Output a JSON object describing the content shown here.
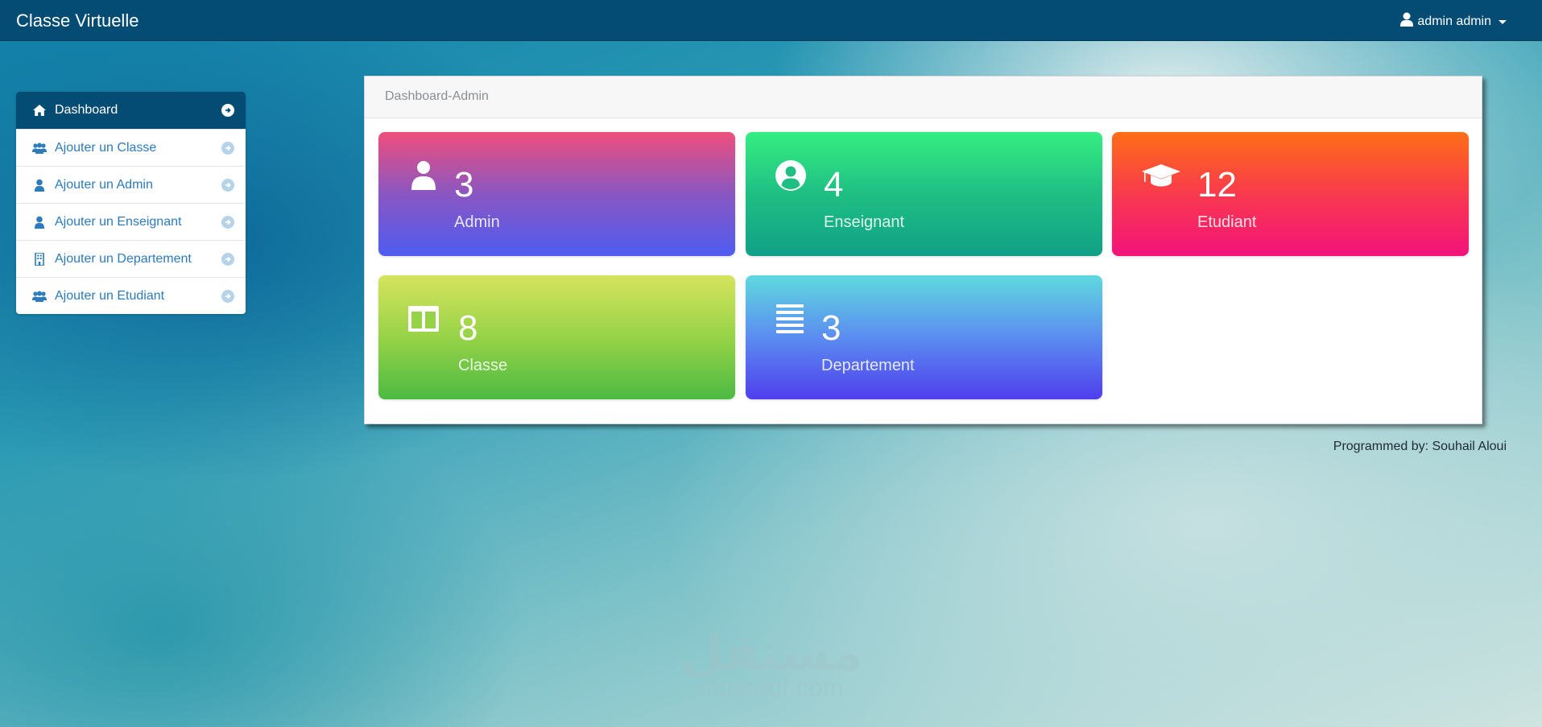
{
  "navbar": {
    "brand": "Classe Virtuelle",
    "user": "admin admin",
    "user_icon": "user-icon"
  },
  "sidebar": {
    "items": [
      {
        "label": "Dashboard",
        "icon": "home-icon",
        "active": true
      },
      {
        "label": "Ajouter un Classe",
        "icon": "users-icon"
      },
      {
        "label": "Ajouter un Admin",
        "icon": "user-icon"
      },
      {
        "label": "Ajouter un Enseignant",
        "icon": "user-icon"
      },
      {
        "label": "Ajouter un Departement",
        "icon": "building-icon"
      },
      {
        "label": "Ajouter un Etudiant",
        "icon": "users-icon"
      }
    ]
  },
  "panel": {
    "heading": "Dashboard-Admin",
    "tiles": [
      {
        "value": "3",
        "label": "Admin",
        "icon": "user-icon"
      },
      {
        "value": "4",
        "label": "Enseignant",
        "icon": "user-circle-icon"
      },
      {
        "value": "12",
        "label": "Etudiant",
        "icon": "graduation-cap-icon"
      },
      {
        "value": "8",
        "label": "Classe",
        "icon": "columns-icon"
      },
      {
        "value": "3",
        "label": "Departement",
        "icon": "list-icon"
      }
    ]
  },
  "footer": {
    "credit": "Programmed by: Souhail Aloui"
  },
  "watermark": {
    "arabic": "مستقل",
    "latin": "mostaql.com"
  },
  "colors": {
    "navbar": "#044c73",
    "link": "#2b7bbd"
  }
}
